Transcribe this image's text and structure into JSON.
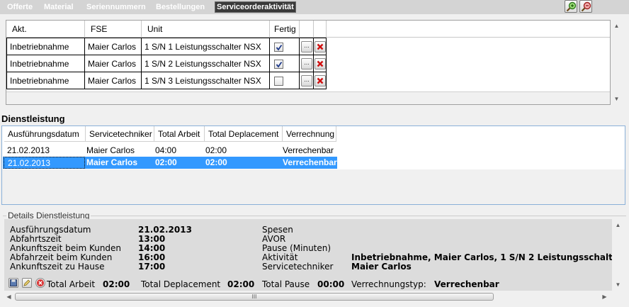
{
  "tabs": [
    {
      "label": "Offerte"
    },
    {
      "label": "Material"
    },
    {
      "label": "Seriennummern"
    },
    {
      "label": "Bestellungen"
    },
    {
      "label": "Serviceorderaktivität"
    }
  ],
  "activities_grid": {
    "columns": [
      "Akt.",
      "FSE",
      "Unit",
      "Fertig"
    ],
    "rows": [
      {
        "akt": "Inbetriebnahme",
        "fse": "Maier Carlos",
        "unit": "1 S/N 1 Leistungsschalter NSX",
        "fertig": true
      },
      {
        "akt": "Inbetriebnahme",
        "fse": "Maier Carlos",
        "unit": "1 S/N 2 Leistungsschalter NSX",
        "fertig": true
      },
      {
        "akt": "Inbetriebnahme",
        "fse": "Maier Carlos",
        "unit": "1 S/N 3 Leistungsschalter NSX",
        "fertig": false
      }
    ],
    "ellipsis_label": "..."
  },
  "dienstleistung": {
    "title": "Dienstleistung",
    "columns": [
      "Ausführungsdatum",
      "Servicetechniker",
      "Total Arbeit",
      "Total Deplacement",
      "Verrechnung"
    ],
    "rows": [
      {
        "datum": "21.02.2013",
        "techniker": "Maier Carlos",
        "arbeit": "04:00",
        "deplacement": "02:00",
        "verrechnung": "Verrechenbar",
        "selected": false
      },
      {
        "datum": "21.02.2013",
        "techniker": "Maier Carlos",
        "arbeit": "02:00",
        "deplacement": "02:00",
        "verrechnung": "Verrechenbar",
        "selected": true
      }
    ]
  },
  "details": {
    "legend": "Details Dienstleistung",
    "left": [
      {
        "label": "Ausführungsdatum",
        "value": "21.02.2013"
      },
      {
        "label": "Abfahrtszeit",
        "value": "13:00"
      },
      {
        "label": "Ankunftszeit beim Kunden",
        "value": "14:00"
      },
      {
        "label": "Abfahrzeit beim Kunden",
        "value": "16:00"
      },
      {
        "label": "Ankunftszeit zu Hause",
        "value": "17:00"
      }
    ],
    "right": [
      {
        "label": "Spesen",
        "value": ""
      },
      {
        "label": "AVOR",
        "value": ""
      },
      {
        "label": "Pause (Minuten)",
        "value": ""
      },
      {
        "label": "Aktivität",
        "value": "Inbetriebnahme, Maier Carlos, 1 S/N 2 Leistungsschalt"
      },
      {
        "label": "Servicetechniker",
        "value": "Maier Carlos"
      }
    ],
    "totals": {
      "arbeit_label": "Total Arbeit",
      "arbeit_value": "02:00",
      "deplacement_label": "Total Deplacement",
      "deplacement_value": "02:00",
      "pause_label": "Total Pause",
      "pause_value": "00:00",
      "verrechnung_label": "Verrechnungstyp:",
      "verrechnung_value": "Verrechenbar"
    },
    "scroll_grip": "III"
  }
}
